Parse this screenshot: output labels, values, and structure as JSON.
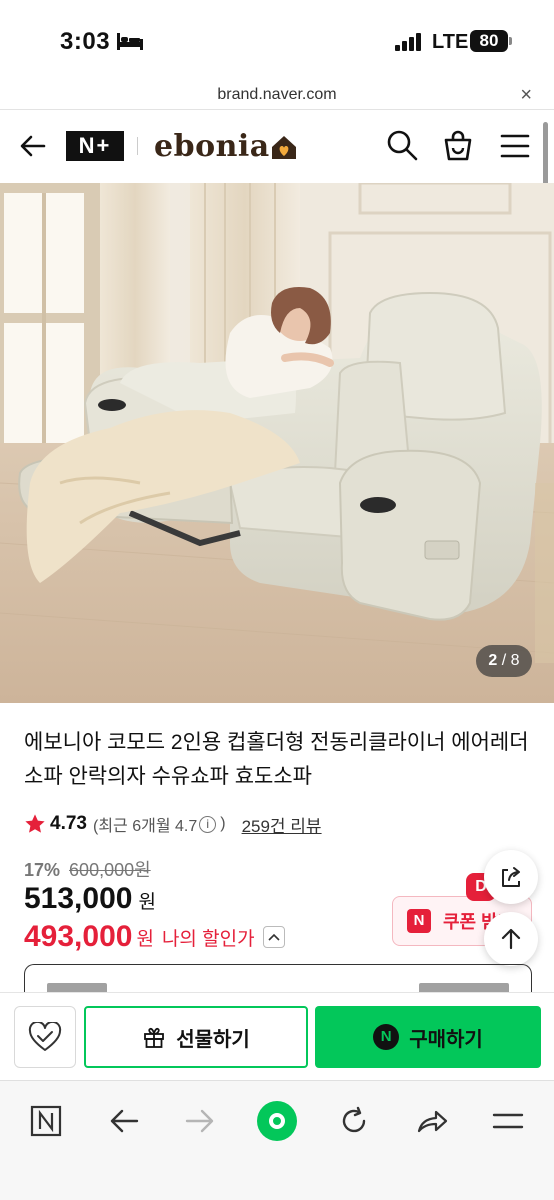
{
  "status": {
    "time": "3:03",
    "network": "LTE",
    "battery": "80"
  },
  "url_bar": {
    "url": "brand.naver.com",
    "close": "×"
  },
  "header": {
    "nplus": "N+",
    "brand": "ebonia"
  },
  "gallery": {
    "current": "2",
    "separator": " / ",
    "total": "8"
  },
  "product": {
    "title": "에보니아 코모드 2인용 컵홀더형 전동리클라이너 에어레더 소파 안락의자 수유쇼파 효도소파",
    "rating": "4.73",
    "rating_sub_prefix": "(최근 6개월 4.7",
    "rating_sub_suffix": ")",
    "review_link": "259건 리뷰",
    "discount_rate": "17%",
    "original_price": "600,000원",
    "sale_price": "513,000",
    "won": "원",
    "my_price": "493,000",
    "my_won": "원",
    "my_price_label": "나의 할인가"
  },
  "coupon": {
    "badge": "D",
    "n": "N",
    "label": "쿠폰 받기"
  },
  "purchase": {
    "gift_label": "선물하기",
    "buy_label": "구매하기",
    "npay": "N"
  },
  "colors": {
    "naver_green": "#03c75a",
    "sale_red": "#e5203a"
  },
  "icons": [
    "back-arrow-icon",
    "search-icon",
    "cart-icon",
    "menu-icon",
    "star-icon",
    "info-icon",
    "share-icon",
    "arrow-up-icon",
    "heart-check-icon",
    "gift-icon",
    "n-icon",
    "forward-arrow-icon",
    "refresh-icon",
    "home-icon"
  ]
}
